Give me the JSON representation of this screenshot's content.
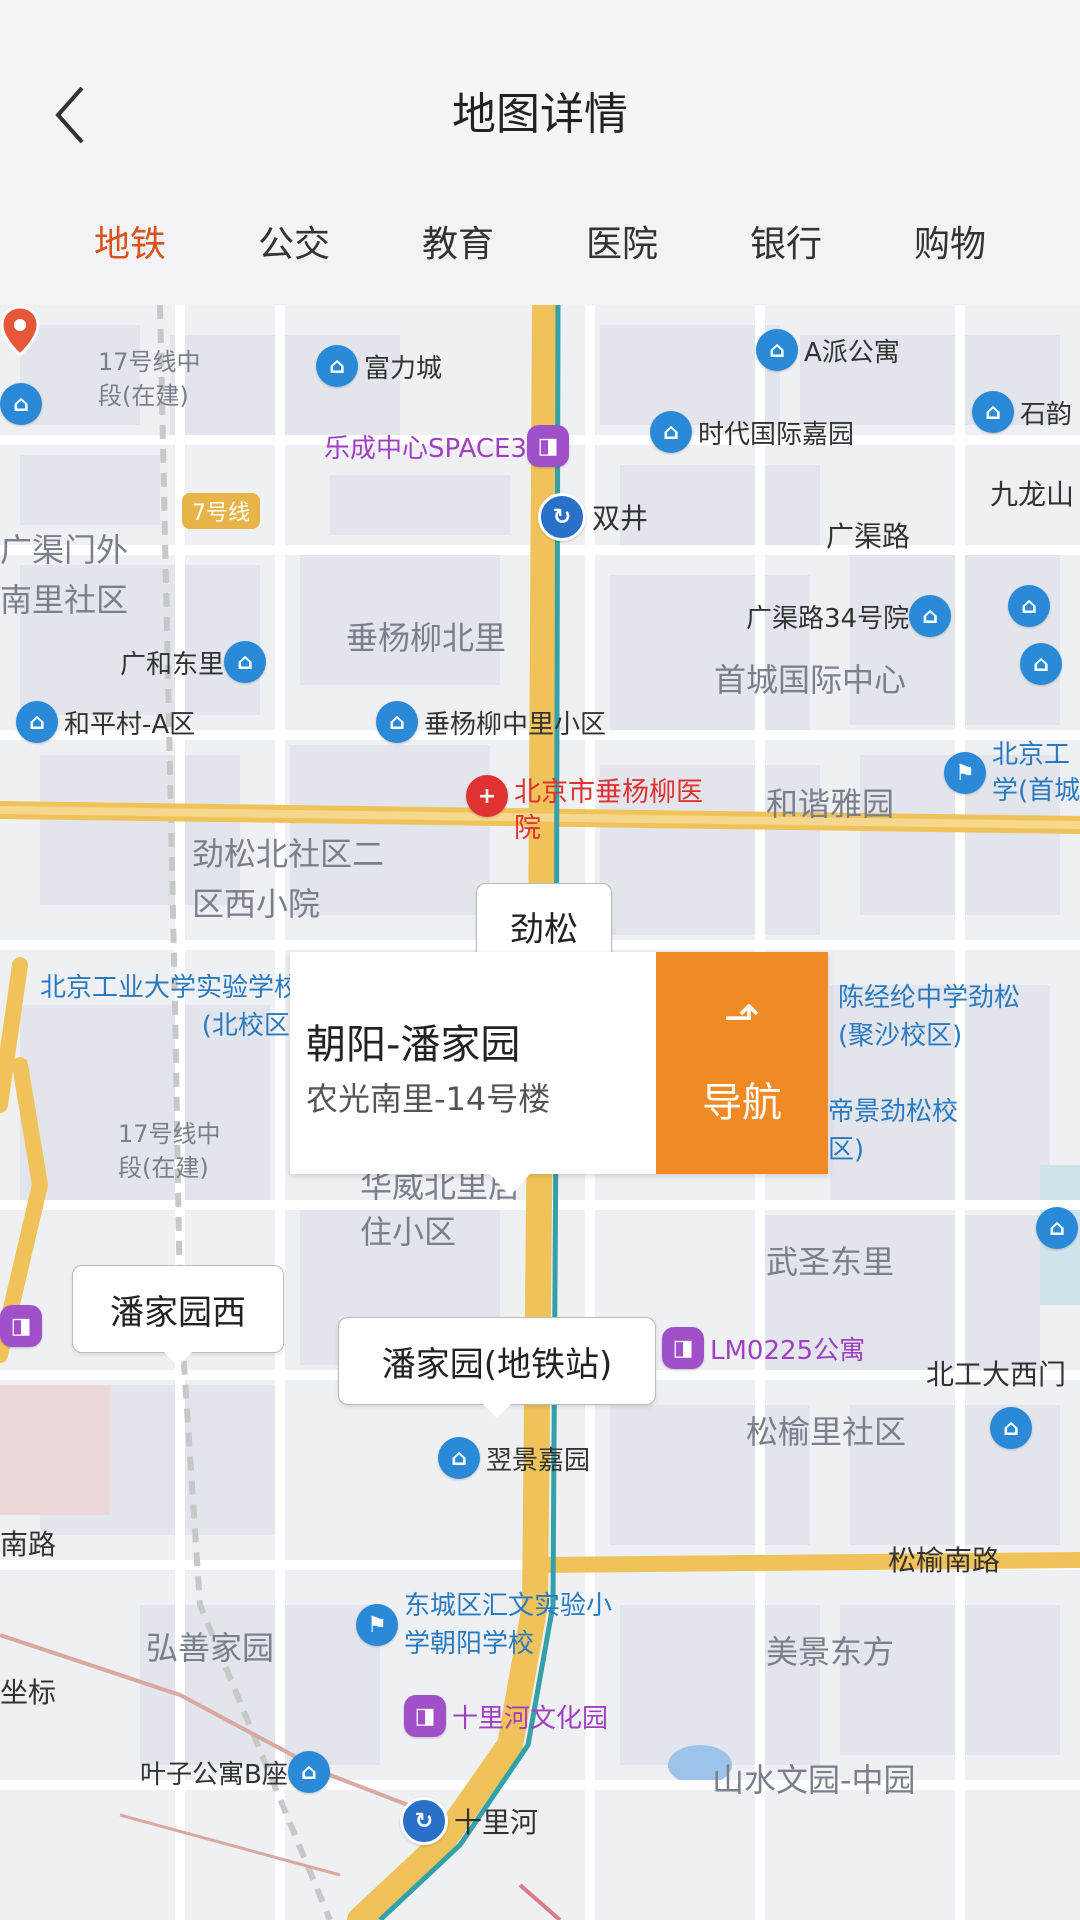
{
  "header": {
    "title": "地图详情"
  },
  "tabs": [
    {
      "label": "地铁",
      "active": true
    },
    {
      "label": "公交",
      "active": false
    },
    {
      "label": "教育",
      "active": false
    },
    {
      "label": "医院",
      "active": false
    },
    {
      "label": "银行",
      "active": false
    },
    {
      "label": "购物",
      "active": false
    }
  ],
  "colors": {
    "accent": "#d9531e",
    "nav_button": "#f08a24"
  },
  "info_card": {
    "name": "朝阳-潘家园",
    "address": "农光南里-14号楼",
    "nav_label": "导航",
    "nav_icon": "turn-arrow-icon"
  },
  "map": {
    "stations": [
      "劲松",
      "潘家园西",
      "潘家园(地铁站)"
    ],
    "metro_stops": [
      "双井",
      "十里河"
    ],
    "line_badge": "7号线",
    "construction_labels": [
      "17号线中段(在建)",
      "17号线中段(在建)"
    ],
    "pois": {
      "fulicheng": "富力城",
      "apai": "A派公寓",
      "space3": "乐成中心SPACE3",
      "shidai": "时代国际嘉园",
      "shiyun": "石韵",
      "guangqu34": "广渠路34号院",
      "guanghe": "广和东里",
      "heping": "和平村-A区",
      "chuizhong": "垂杨柳中里小区",
      "hospital": "北京市垂杨柳医院",
      "bjgy_school": "北京工业大学实验学校(北校区)",
      "chenjinglun": "陈经纶中学劲松(聚沙校区)",
      "dijing": "帝景劲松校区)",
      "lm0225": "LM0225公寓",
      "yijing": "翌景嘉园",
      "huiwen": "东城区汇文实验小学朝阳学校",
      "shilihe_park": "十里河文化园",
      "yezi": "叶子公寓B座",
      "bjgd": "北京工学(首城"
    },
    "areas": {
      "guangqumen": "广渠门外南里社区",
      "chuibei": "垂杨柳北里",
      "shoucheng": "首城国际中心",
      "hexie": "和谐雅园",
      "jinsongbei": "劲松北社区二区西小院",
      "huawei": "华威北里居住小区",
      "wusheng": "武圣东里",
      "songyu": "松榆里社区",
      "hongshan": "弘善家园",
      "meijing": "美景东方",
      "shanshui": "山水文园-中园"
    },
    "roads": {
      "guangqu": "广渠路",
      "jiulong": "九龙山",
      "beigong": "北工大西门",
      "songyunan": "松榆南路",
      "nanlu": "南路",
      "zuobiao": "坐标"
    }
  }
}
